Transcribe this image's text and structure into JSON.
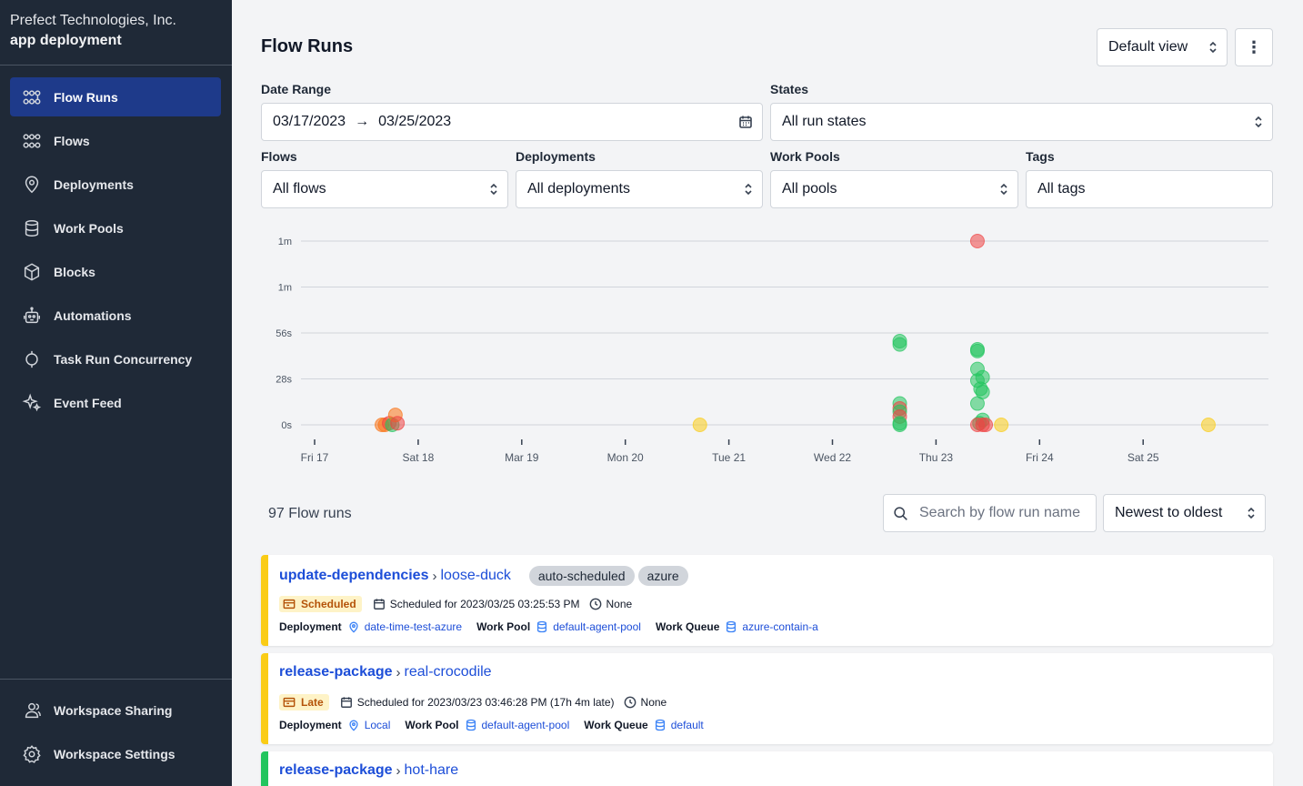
{
  "workspace": {
    "org": "Prefect Technologies, Inc.",
    "name": "app deployment"
  },
  "sidebar": {
    "items": [
      {
        "label": "Flow Runs",
        "icon": "flow-runs-icon",
        "active": true
      },
      {
        "label": "Flows",
        "icon": "flows-icon"
      },
      {
        "label": "Deployments",
        "icon": "map-pin-icon"
      },
      {
        "label": "Work Pools",
        "icon": "database-icon"
      },
      {
        "label": "Blocks",
        "icon": "cube-icon"
      },
      {
        "label": "Automations",
        "icon": "robot-icon"
      },
      {
        "label": "Task Run Concurrency",
        "icon": "concurrency-icon"
      },
      {
        "label": "Event Feed",
        "icon": "sparkles-icon"
      }
    ],
    "bottom": [
      {
        "label": "Workspace Sharing",
        "icon": "users-icon"
      },
      {
        "label": "Workspace Settings",
        "icon": "gear-icon"
      }
    ]
  },
  "header": {
    "title": "Flow Runs",
    "view": "Default view",
    "menu": "⋮"
  },
  "filters": {
    "date_range_label": "Date Range",
    "date_start": "03/17/2023",
    "date_arrow": "→",
    "date_end": "03/25/2023",
    "states_label": "States",
    "states_value": "All run states",
    "flows_label": "Flows",
    "flows_value": "All flows",
    "deployments_label": "Deployments",
    "deployments_value": "All deployments",
    "work_pools_label": "Work Pools",
    "work_pools_value": "All pools",
    "tags_label": "Tags",
    "tags_value": "All tags"
  },
  "chart_data": {
    "type": "scatter",
    "y_ticks": [
      "1m",
      "1m",
      "56s",
      "28s",
      "0s"
    ],
    "x_ticks": [
      "Fri 17",
      "Sat 18",
      "Mar 19",
      "Mon 20",
      "Tue 21",
      "Wed 22",
      "Thu 23",
      "Fri 24",
      "Sat 25"
    ],
    "xlim_days": [
      0,
      9
    ],
    "ylim_seconds": [
      0,
      112
    ],
    "grid": true,
    "colors": {
      "completed": "#22c55e",
      "failed": "#ef4444",
      "scheduled": "#facc15",
      "crashed": "#f97316",
      "late": "#eab308"
    },
    "points": [
      {
        "day": 0.65,
        "seconds": 0,
        "state": "crashed"
      },
      {
        "day": 0.68,
        "seconds": 0,
        "state": "crashed"
      },
      {
        "day": 0.72,
        "seconds": 1,
        "state": "failed"
      },
      {
        "day": 0.75,
        "seconds": 0,
        "state": "completed"
      },
      {
        "day": 0.78,
        "seconds": 6,
        "state": "crashed"
      },
      {
        "day": 0.8,
        "seconds": 1,
        "state": "failed"
      },
      {
        "day": 3.72,
        "seconds": 0,
        "state": "scheduled"
      },
      {
        "day": 5.65,
        "seconds": 49,
        "state": "completed"
      },
      {
        "day": 5.65,
        "seconds": 51,
        "state": "completed"
      },
      {
        "day": 5.65,
        "seconds": 13,
        "state": "completed"
      },
      {
        "day": 5.65,
        "seconds": 10,
        "state": "failed"
      },
      {
        "day": 5.65,
        "seconds": 8,
        "state": "completed"
      },
      {
        "day": 5.65,
        "seconds": 5,
        "state": "failed"
      },
      {
        "day": 5.65,
        "seconds": 1,
        "state": "completed"
      },
      {
        "day": 5.65,
        "seconds": 0,
        "state": "completed"
      },
      {
        "day": 6.4,
        "seconds": 112,
        "state": "failed"
      },
      {
        "day": 6.4,
        "seconds": 46,
        "state": "completed"
      },
      {
        "day": 6.4,
        "seconds": 45,
        "state": "completed"
      },
      {
        "day": 6.4,
        "seconds": 34,
        "state": "completed"
      },
      {
        "day": 6.45,
        "seconds": 29,
        "state": "completed"
      },
      {
        "day": 6.4,
        "seconds": 27,
        "state": "completed"
      },
      {
        "day": 6.45,
        "seconds": 20,
        "state": "completed"
      },
      {
        "day": 6.43,
        "seconds": 22,
        "state": "completed"
      },
      {
        "day": 6.4,
        "seconds": 13,
        "state": "completed"
      },
      {
        "day": 6.45,
        "seconds": 3,
        "state": "completed"
      },
      {
        "day": 6.42,
        "seconds": 1,
        "state": "completed"
      },
      {
        "day": 6.4,
        "seconds": 0,
        "state": "failed"
      },
      {
        "day": 6.45,
        "seconds": 0,
        "state": "failed"
      },
      {
        "day": 6.48,
        "seconds": 0,
        "state": "failed"
      },
      {
        "day": 6.63,
        "seconds": 0,
        "state": "scheduled"
      },
      {
        "day": 8.63,
        "seconds": 0,
        "state": "scheduled"
      }
    ]
  },
  "list": {
    "count": "97 Flow runs",
    "search_placeholder": "Search by flow run name",
    "sort": "Newest to oldest"
  },
  "runs": [
    {
      "flow": "update-dependencies",
      "run": "loose-duck",
      "tags": [
        "auto-scheduled",
        "azure"
      ],
      "state": "Scheduled",
      "state_color": "#facc15",
      "schedule": "Scheduled for 2023/03/25 03:25:53 PM",
      "duration": "None",
      "deployment_label": "Deployment",
      "deployment": "date-time-test-azure",
      "pool_label": "Work Pool",
      "pool": "default-agent-pool",
      "queue_label": "Work Queue",
      "queue": "azure-contain-a"
    },
    {
      "flow": "release-package",
      "run": "real-crocodile",
      "tags": [],
      "state": "Late",
      "state_color": "#facc15",
      "schedule": "Scheduled for 2023/03/23 03:46:28 PM (17h 4m late)",
      "duration": "None",
      "deployment_label": "Deployment",
      "deployment": "Local",
      "pool_label": "Work Pool",
      "pool": "default-agent-pool",
      "queue_label": "Work Queue",
      "queue": "default"
    },
    {
      "flow": "release-package",
      "run": "hot-hare",
      "state_color": "#22c55e"
    }
  ]
}
